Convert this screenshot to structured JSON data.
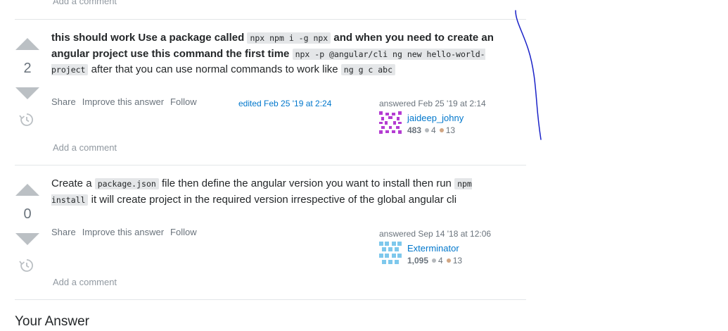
{
  "top_comment": {
    "add_comment": "Add a comment"
  },
  "answers": [
    {
      "votes": "2",
      "body": {
        "t1": "this should work Use a package called ",
        "c1": "npx npm i -g npx",
        "t2": " and when you need to create an angular project use this command the first time ",
        "c2": "npx -p @angular/cli ng new hello-world-project",
        "t3": " after that you can use normal commands to work like ",
        "c3": "ng g c abc"
      },
      "menu": {
        "share": "Share",
        "improve": "Improve this answer",
        "follow": "Follow"
      },
      "edited": "edited Feb 25 '19 at 2:24",
      "answered": "answered Feb 25 '19 at 2:14",
      "user": {
        "name": "jaideep_johny",
        "rep": "483",
        "silver": "4",
        "bronze": "13"
      },
      "add_comment": "Add a comment"
    },
    {
      "votes": "0",
      "body": {
        "t1": "Create a ",
        "c1": "package.json",
        "t2": " file then define the angular version you want to install then run ",
        "c2": "npm install",
        "t3": " it will create project in the required version irrespective of the global angular cli"
      },
      "menu": {
        "share": "Share",
        "improve": "Improve this answer",
        "follow": "Follow"
      },
      "answered": "answered Sep 14 '18 at 12:06",
      "user": {
        "name": "Exterminator",
        "rep": "1,095",
        "silver": "4",
        "bronze": "13"
      },
      "add_comment": "Add a comment"
    }
  ],
  "your_answer": "Your Answer",
  "colors": {
    "link": "#0077cc",
    "muted": "#6a737c",
    "vote_arrow": "#bbc0c4",
    "silver_badge": "#b4b8bc",
    "bronze_badge": "#d1a684",
    "annotation_stroke": "#1a22c8"
  }
}
